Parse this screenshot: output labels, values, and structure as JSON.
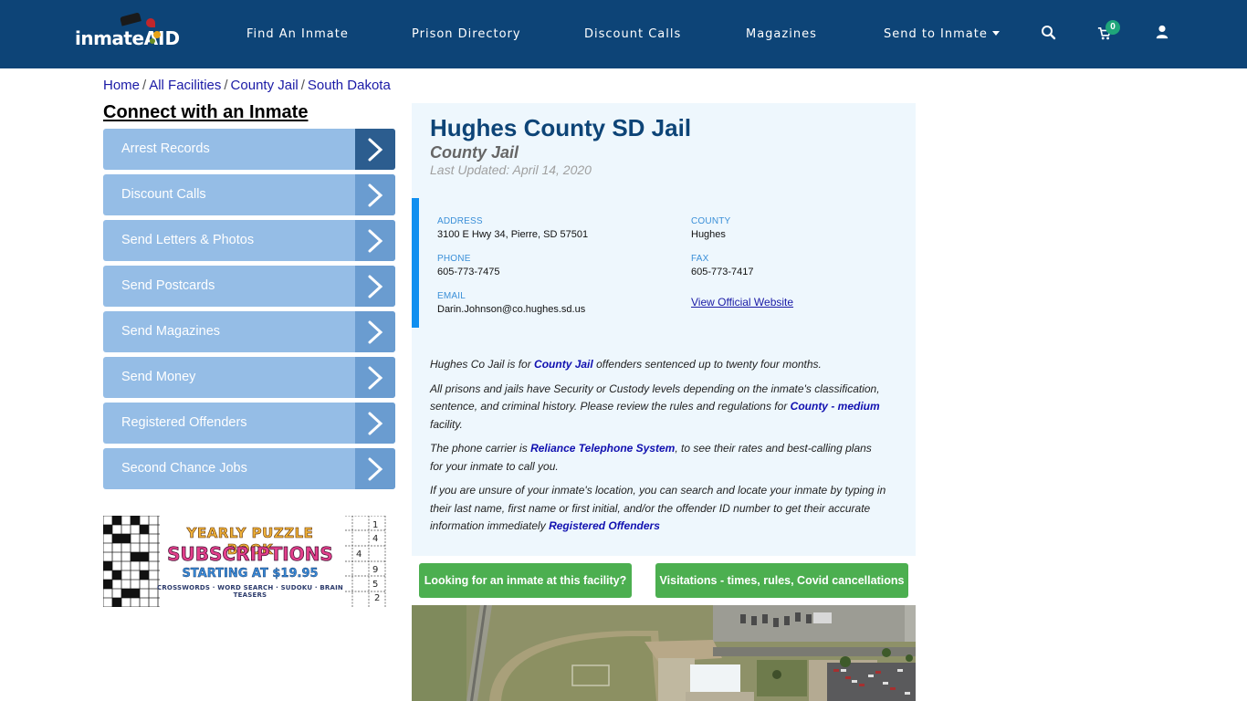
{
  "header": {
    "logo": {
      "part1": "inmate",
      "part2": "AID"
    },
    "nav": [
      {
        "label": "Find An Inmate"
      },
      {
        "label": "Prison Directory"
      },
      {
        "label": "Discount Calls"
      },
      {
        "label": "Magazines"
      },
      {
        "label": "Send to Inmate",
        "has_dropdown": true
      }
    ],
    "icons": [
      "search-icon",
      "cart-icon",
      "user-icon"
    ],
    "cart_count": "0",
    "colors": {
      "bar": "#0d4477",
      "badge": "#1fa67a"
    }
  },
  "breadcrumb": {
    "items": [
      "Home",
      "All Facilities",
      "County Jail",
      "South Dakota"
    ],
    "separator": "/"
  },
  "sidebar": {
    "title": "Connect with an Inmate",
    "items": [
      {
        "label": "Arrest Records",
        "active": true
      },
      {
        "label": "Discount Calls"
      },
      {
        "label": "Send Letters & Photos"
      },
      {
        "label": "Send Postcards"
      },
      {
        "label": "Send Magazines"
      },
      {
        "label": "Send Money"
      },
      {
        "label": "Registered Offenders"
      },
      {
        "label": "Second Chance Jobs"
      }
    ],
    "ad": {
      "line1": "YEARLY PUZZLE BOOK",
      "line2": "SUBSCRIPTIONS",
      "line3": "STARTING AT $19.95",
      "line4": "CROSSWORDS · WORD SEARCH · SUDOKU · BRAIN TEASERS"
    }
  },
  "facility": {
    "title": "Hughes County SD Jail",
    "type": "County Jail",
    "last_updated": "Last Updated: April 14, 2020",
    "info": {
      "address_label": "ADDRESS",
      "address": "3100 E Hwy 34, Pierre, SD 57501",
      "county_label": "COUNTY",
      "county": "Hughes",
      "phone_label": "PHONE",
      "phone": "605-773-7475",
      "fax_label": "FAX",
      "fax": "605-773-7417",
      "email_label": "EMAIL",
      "email": "Darin.Johnson@co.hughes.sd.us",
      "website_link": "View Official Website"
    },
    "description": {
      "p1_a": "Hughes Co Jail is for ",
      "p1_link": "County Jail",
      "p1_b": " offenders sentenced up to twenty four months.",
      "p2_a": "All prisons and jails have Security or Custody levels depending on the inmate's classification, sentence, and criminal history. Please review the rules and regulations for ",
      "p2_link": "County - medium",
      "p2_b": " facility.",
      "p3_a": "The phone carrier is ",
      "p3_link": "Reliance Telephone System",
      "p3_b": ", to see their rates and best-calling plans for your inmate to call you.",
      "p4_a": "If you are unsure of your inmate's location, you can search and locate your inmate by typing in their last name, first name or first initial, and/or the offender ID number to get their accurate information immediately ",
      "p4_link": "Registered Offenders"
    },
    "buttons": {
      "find_inmate": "Looking for an inmate at this facility?",
      "visitation": "Visitations - times, rules, Covid cancellations"
    }
  }
}
